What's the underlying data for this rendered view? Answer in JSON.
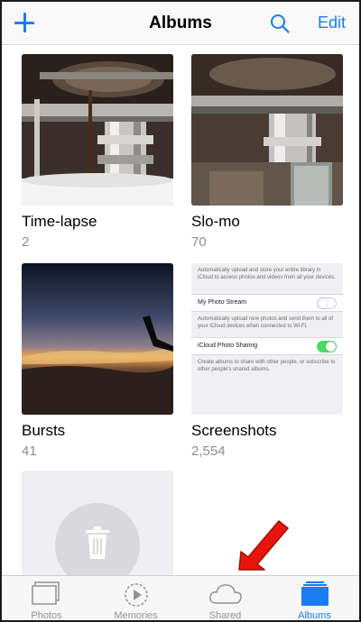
{
  "navbar": {
    "title": "Albums",
    "edit_label": "Edit",
    "add_icon": "plus-icon",
    "search_icon": "search-icon"
  },
  "albums": [
    {
      "title": "Time-lapse",
      "count": "2",
      "thumb": "espresso-machine-photo"
    },
    {
      "title": "Slo-mo",
      "count": "70",
      "thumb": "espresso-machine-photo"
    },
    {
      "title": "Bursts",
      "count": "41",
      "thumb": "sunset-airplane-wing-photo"
    },
    {
      "title": "Screenshots",
      "count": "2,554",
      "thumb": "settings-screenshot"
    }
  ],
  "screenshot_thumb": {
    "intro": "Automatically upload and store your entire library in iCloud to access photos and videos from all your devices.",
    "row1_label": "My Photo Stream",
    "row1_note": "Automatically upload new photos and send them to all of your iCloud devices when connected to Wi-Fi.",
    "row2_label": "iCloud Photo Sharing",
    "row2_note": "Create albums to share with other people, or subscribe to other people's shared albums."
  },
  "tabs": [
    {
      "label": "Photos",
      "icon": "photos-icon"
    },
    {
      "label": "Memories",
      "icon": "memories-icon"
    },
    {
      "label": "Shared",
      "icon": "cloud-icon"
    },
    {
      "label": "Albums",
      "icon": "albums-icon"
    }
  ],
  "colors": {
    "accent": "#1a7ef2",
    "toggle_on": "#4cd964",
    "arrow": "#e8150d"
  }
}
